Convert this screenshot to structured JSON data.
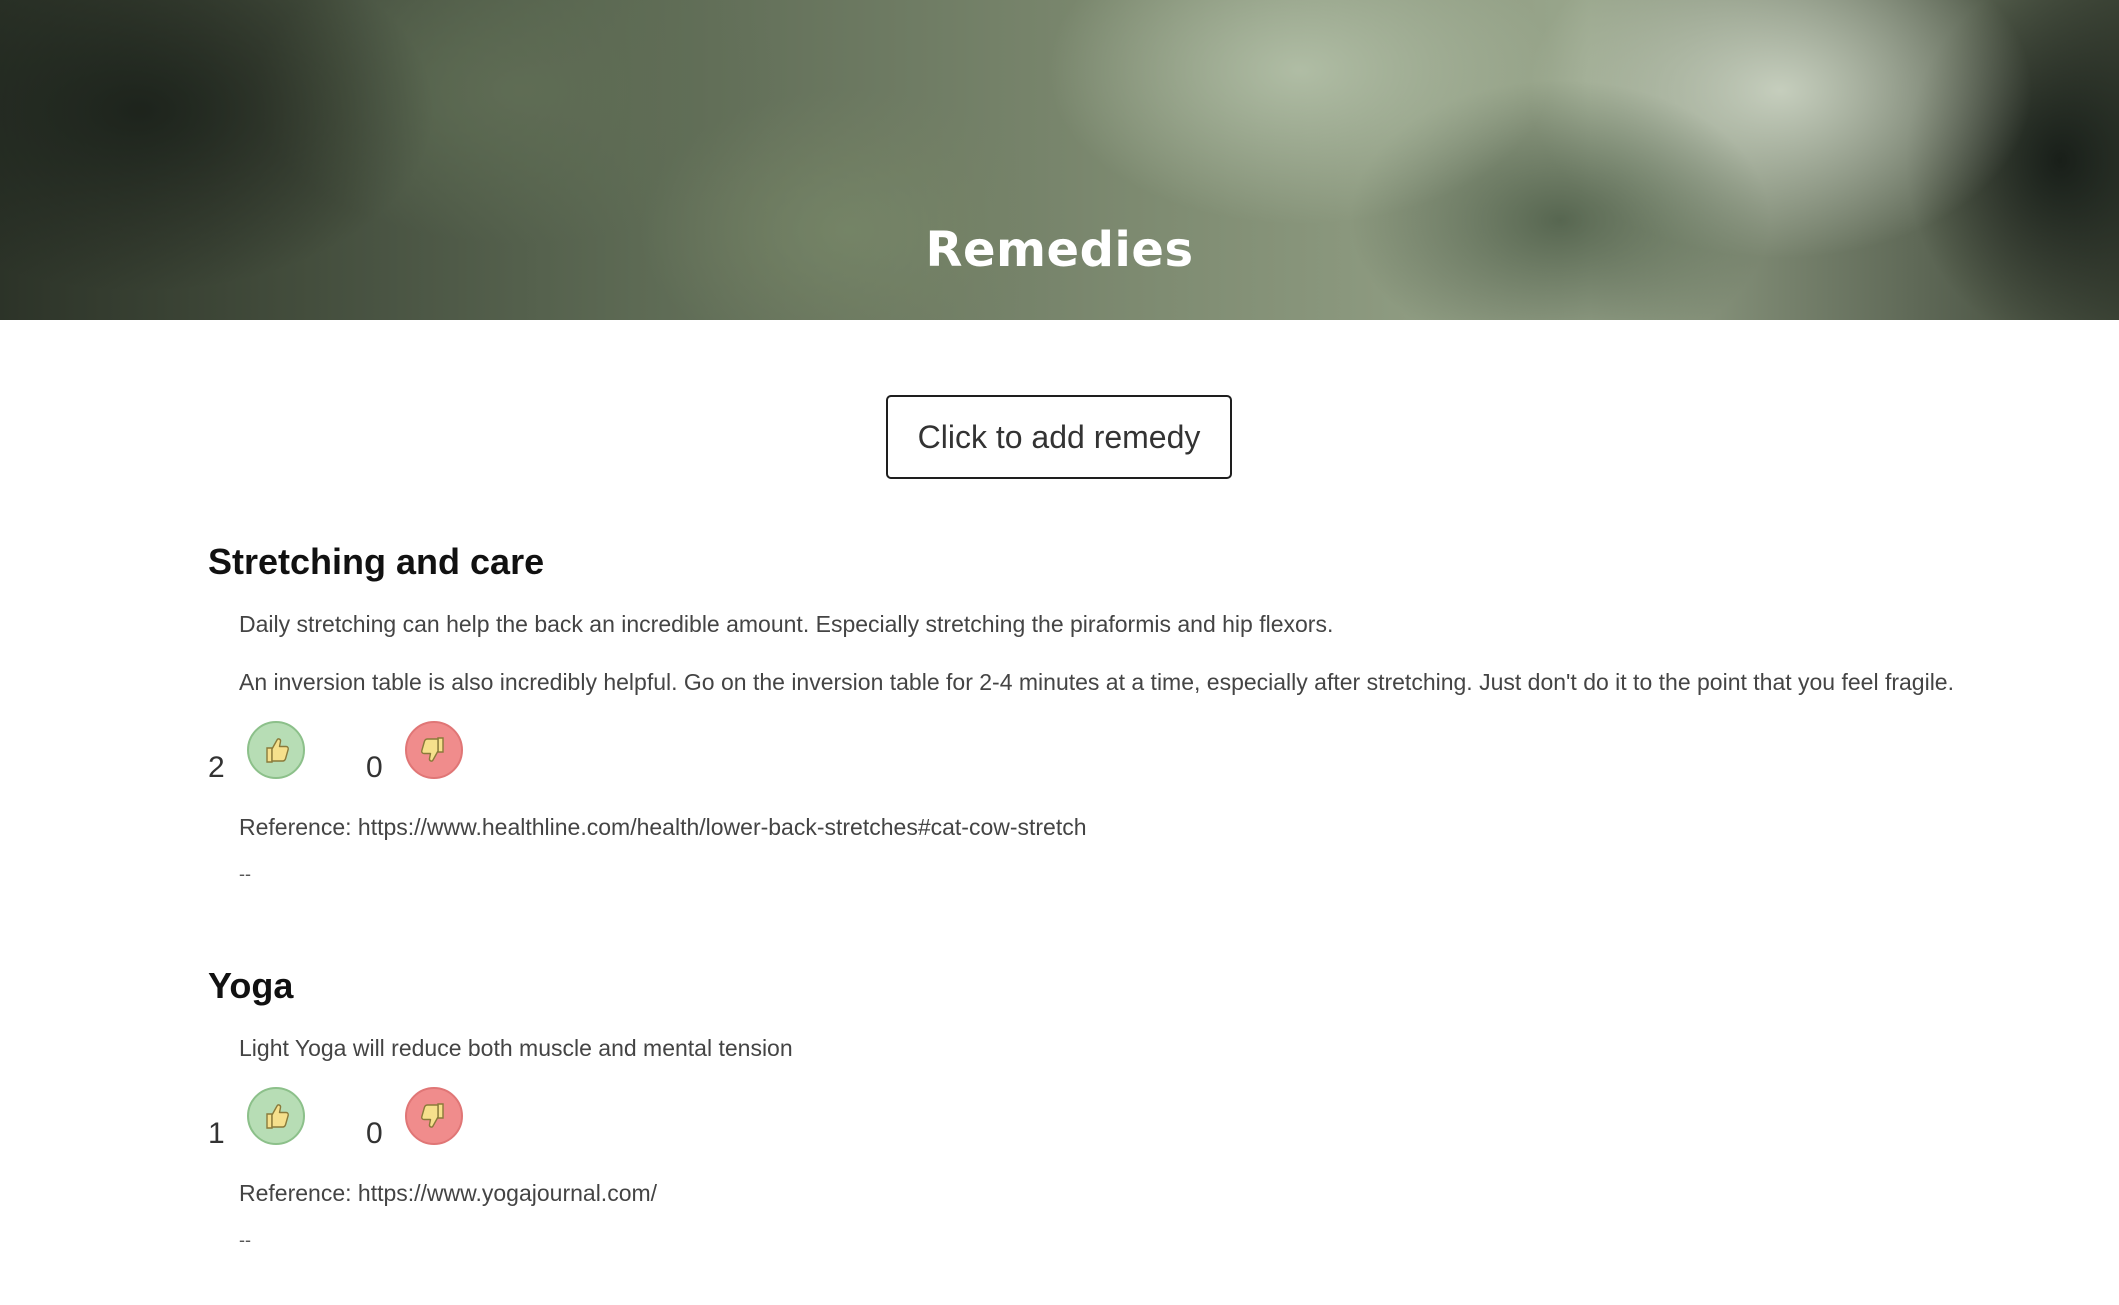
{
  "header": {
    "title": "Remedies"
  },
  "add_button": {
    "label": "Click to add remedy"
  },
  "remedies": [
    {
      "title": "Stretching and care",
      "paragraphs": [
        "Daily stretching can help the back an incredible amount. Especially stretching the piraformis and hip flexors.",
        "An inversion table is also incredibly helpful. Go on the inversion table for 2-4 minutes at a time, especially after stretching. Just don't do it to the point that you feel fragile."
      ],
      "upvotes": "2",
      "downvotes": "0",
      "reference": "Reference: https://www.healthline.com/health/lower-back-stretches#cat-cow-stretch",
      "separator": "--"
    },
    {
      "title": "Yoga",
      "paragraphs": [
        "Light Yoga will reduce both muscle and mental tension"
      ],
      "upvotes": "1",
      "downvotes": "0",
      "reference": "Reference: https://www.yogajournal.com/",
      "separator": "--"
    }
  ],
  "icons": {
    "upvote": "thumbs-up-icon",
    "downvote": "thumbs-down-icon"
  },
  "colors": {
    "upvote_bg": "#b7ddb5",
    "downvote_bg": "#f08c8c",
    "thumb": "#f6e08c"
  }
}
